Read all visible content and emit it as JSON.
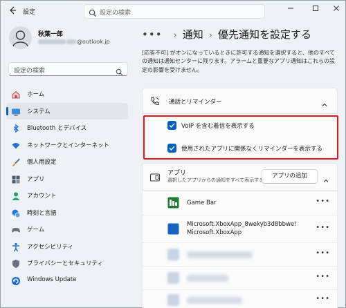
{
  "window": {
    "app_title": "設定",
    "search_placeholder": "設定の検索"
  },
  "user": {
    "name": "秋葉一郎",
    "email_suffix": "@outlook.jp"
  },
  "sidebar": {
    "search_placeholder": "設定の検索",
    "items": [
      {
        "label": "ホーム",
        "icon": "home-icon",
        "color": "#c0474a"
      },
      {
        "label": "システム",
        "icon": "monitor-icon",
        "color": "#0067c0",
        "active": true
      },
      {
        "label": "Bluetooth とデバイス",
        "icon": "bluetooth-icon",
        "color": "#1a73e8"
      },
      {
        "label": "ネットワークとインターネット",
        "icon": "wifi-icon",
        "color": "#2a6fd6"
      },
      {
        "label": "個人用設定",
        "icon": "brush-icon",
        "color": "#e88e2b"
      },
      {
        "label": "アプリ",
        "icon": "apps-icon",
        "color": "#4a5b73"
      },
      {
        "label": "アカウント",
        "icon": "account-icon",
        "color": "#2aa36b"
      },
      {
        "label": "時刻と言語",
        "icon": "clock-globe-icon",
        "color": "#2b7bd5"
      },
      {
        "label": "ゲーム",
        "icon": "gamepad-icon",
        "color": "#6b7280"
      },
      {
        "label": "アクセシビリティ",
        "icon": "accessibility-icon",
        "color": "#1f6fc5"
      },
      {
        "label": "プライバシーとセキュリティ",
        "icon": "shield-icon",
        "color": "#6b7280"
      },
      {
        "label": "Windows Update",
        "icon": "update-icon",
        "color": "#1b6fcf"
      }
    ]
  },
  "breadcrumb": {
    "dots": "•••",
    "parent": "通知",
    "current": "優先通知を設定する"
  },
  "description": "[応答不可] がオンになっているときに許可する通知を選択すると、他のすべての通知は通知センターに残ります。アラームと重要なアプリ通知はこれらの設定の影響を受けません。",
  "calls_section": {
    "title": "通話とリマインダー",
    "options": [
      {
        "label": "VoIP を含む着信を表示する",
        "checked": true
      },
      {
        "label": "使用されたアプリに関係なくリマインダーを表示する",
        "checked": true
      }
    ]
  },
  "apps_section": {
    "title": "アプリ",
    "subtitle": "選択したアプリからの通知をすべて表示する",
    "add_button": "アプリの追加",
    "apps": [
      {
        "name": "Game Bar",
        "icon": "gamebar-icon"
      },
      {
        "name": "Microsoft.XboxApp_8wekyb3d8bbwe!",
        "name2": "Microsoft.XboxApp",
        "icon": "xbox-app-icon"
      }
    ],
    "more_label": "•••"
  }
}
